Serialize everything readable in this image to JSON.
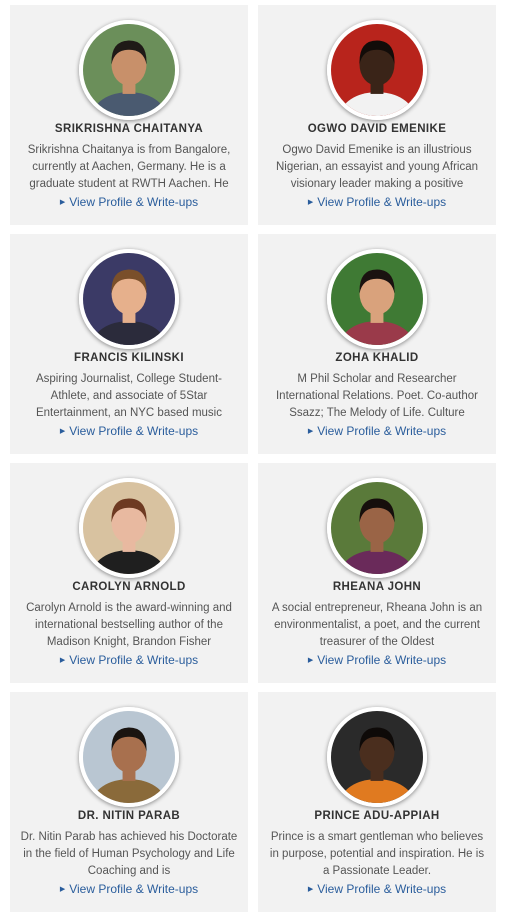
{
  "profiles": [
    {
      "name": "SRIKRISHNA CHAITANYA",
      "bio": "Srikrishna Chaitanya is from Bangalore, currently at Aachen, Germany. He is a graduate student at RWTH Aachen. He",
      "link": "View Profile & Write-ups",
      "colors": {
        "bg": "#6b8f5a",
        "skin": "#c8906a",
        "hair": "#1f1a17",
        "shirt": "#4a5a70"
      }
    },
    {
      "name": "OGWO DAVID EMENIKE",
      "bio": "Ogwo David Emenike is an illustrious Nigerian, an essayist and young African visionary leader making a positive",
      "link": "View Profile & Write-ups",
      "colors": {
        "bg": "#b8241c",
        "skin": "#3a2418",
        "hair": "#120c09",
        "shirt": "#f2f2f2"
      }
    },
    {
      "name": "FRANCIS KILINSKI",
      "bio": "Aspiring Journalist, College Student-Athlete, and associate of 5Star Entertainment, an NYC based music",
      "link": "View Profile & Write-ups",
      "colors": {
        "bg": "#3b3a66",
        "skin": "#e6b08c",
        "hair": "#7a4f2a",
        "shirt": "#2b2b3b"
      }
    },
    {
      "name": "ZOHA KHALID",
      "bio": "M Phil Scholar and Researcher International Relations. Poet. Co-author Ssazz; The Melody of Life. Culture",
      "link": "View Profile & Write-ups",
      "colors": {
        "bg": "#3f7a34",
        "skin": "#d9a27c",
        "hair": "#1a1210",
        "shirt": "#9a3a4a"
      }
    },
    {
      "name": "CAROLYN ARNOLD",
      "bio": "Carolyn Arnold is the award-winning and international bestselling author of the Madison Knight, Brandon Fisher",
      "link": "View Profile & Write-ups",
      "colors": {
        "bg": "#d8c2a0",
        "skin": "#e8b9a0",
        "hair": "#6e3a22",
        "shirt": "#1f1f1f"
      }
    },
    {
      "name": "RHEANA JOHN",
      "bio": "A social entrepreneur, Rheana John is an environmentalist, a poet, and the current treasurer of the Oldest",
      "link": "View Profile & Write-ups",
      "colors": {
        "bg": "#5a7a3a",
        "skin": "#9a6446",
        "hair": "#160f0c",
        "shirt": "#6a2a5a"
      }
    },
    {
      "name": "DR. NITIN PARAB",
      "bio": "Dr. Nitin Parab has achieved his Doctorate in the field of Human Psychology and Life Coaching and is",
      "link": "View Profile & Write-ups",
      "colors": {
        "bg": "#b9c6d2",
        "skin": "#a8704e",
        "hair": "#1a1410",
        "shirt": "#8a6a3a"
      }
    },
    {
      "name": "PRINCE ADU-APPIAH",
      "bio": "Prince is a smart gentleman who believes in purpose, potential and inspiration. He is a Passionate Leader.",
      "link": "View Profile & Write-ups",
      "colors": {
        "bg": "#2a2a2a",
        "skin": "#4a2e1e",
        "hair": "#0e0a08",
        "shirt": "#e07a20"
      }
    }
  ]
}
